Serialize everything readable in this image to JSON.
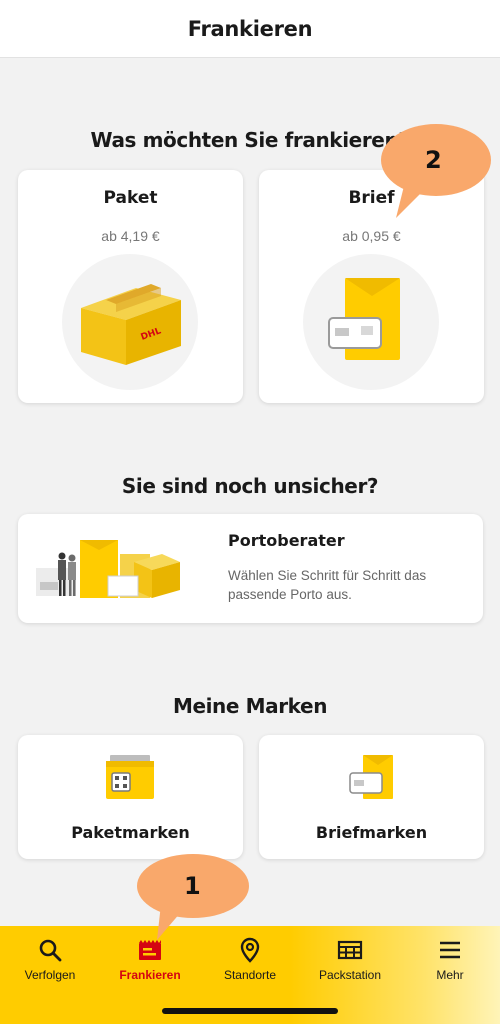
{
  "header": {
    "title": "Frankieren"
  },
  "sections": {
    "frankieren_title": "Was möchten Sie frankieren?",
    "unsicher_title": "Sie sind noch unsicher?",
    "marken_title": "Meine Marken"
  },
  "options": [
    {
      "title": "Paket",
      "price": "ab 4,19 €",
      "illustration": "package-box-icon"
    },
    {
      "title": "Brief",
      "price": "ab 0,95 €",
      "illustration": "letter-envelope-icon"
    }
  ],
  "portoberater": {
    "title": "Portoberater",
    "description": "Wählen Sie Schritt für Schritt das passende Porto aus."
  },
  "marken": [
    {
      "label": "Paketmarken",
      "illustration": "parcel-label-icon"
    },
    {
      "label": "Briefmarken",
      "illustration": "letter-stamp-icon"
    }
  ],
  "tabbar": {
    "items": [
      {
        "label": "Verfolgen",
        "icon": "search-icon",
        "active": false
      },
      {
        "label": "Frankieren",
        "icon": "stamp-icon",
        "active": true
      },
      {
        "label": "Standorte",
        "icon": "location-pin-icon",
        "active": false
      },
      {
        "label": "Packstation",
        "icon": "packstation-icon",
        "active": false
      },
      {
        "label": "Mehr",
        "icon": "menu-icon",
        "active": false
      }
    ]
  },
  "annotations": [
    {
      "label": "1"
    },
    {
      "label": "2"
    }
  ],
  "colors": {
    "dhl_yellow": "#ffcc00",
    "dhl_red": "#d40511",
    "annotation_orange": "#f9a86b",
    "background": "#f2f2f2"
  }
}
